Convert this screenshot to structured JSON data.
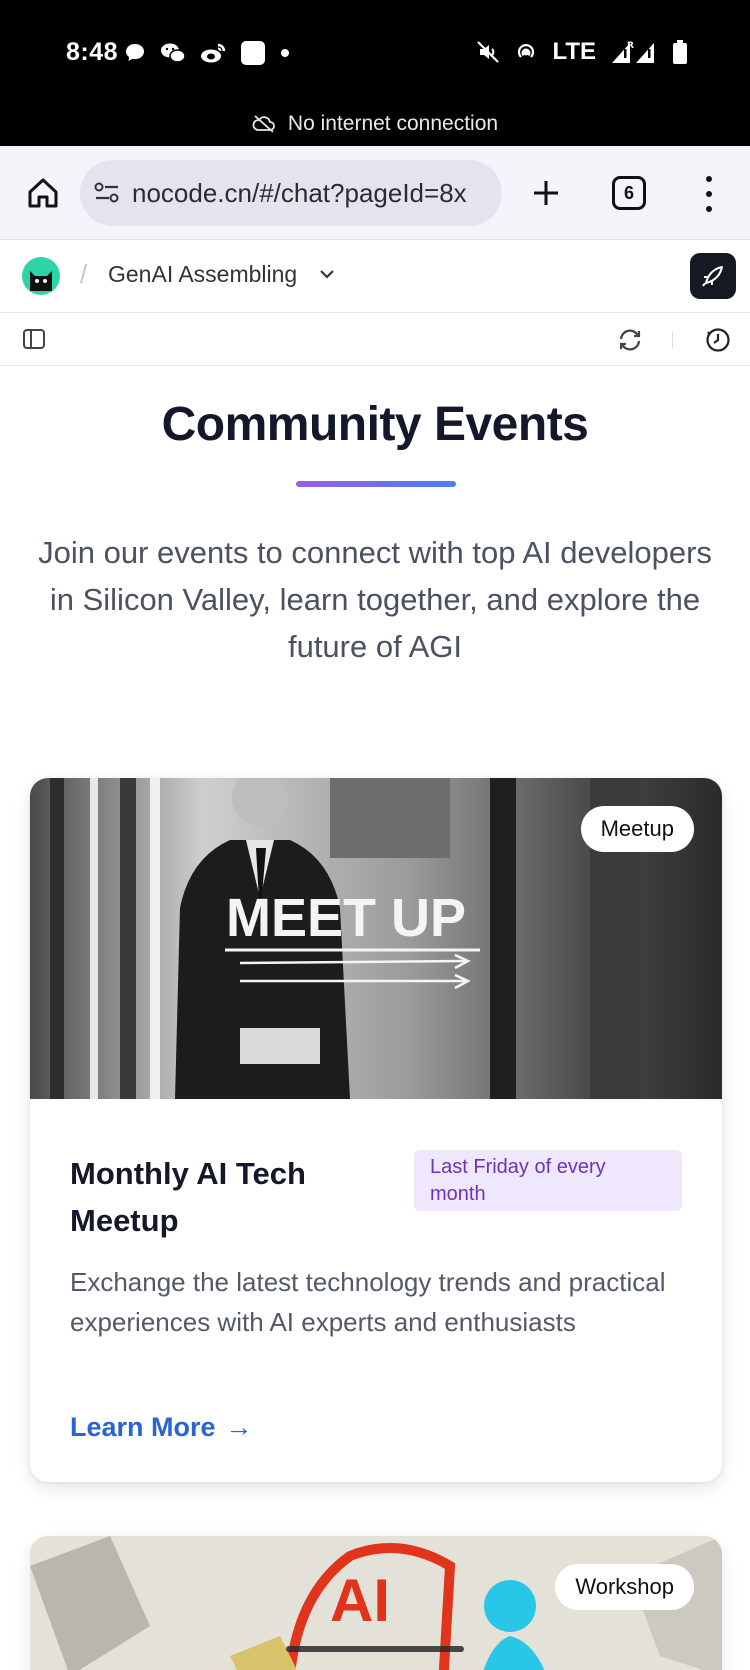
{
  "status_bar": {
    "time": "8:48",
    "network": "LTE",
    "offline_message": "No internet connection",
    "icons": [
      "chat-bubble-icon",
      "wechat-icon",
      "weibo-icon",
      "app-square-icon",
      "dot-icon",
      "mute-icon",
      "hotspot-icon",
      "signal-icon",
      "battery-icon"
    ]
  },
  "browser": {
    "url": "nocode.cn/#/chat?pageId=8x",
    "tab_count": "6"
  },
  "app_header": {
    "separator": "/",
    "project_name": "GenAI Assembling"
  },
  "section": {
    "title": "Community Events",
    "description": "Join our events to connect with top AI developers in Silicon Valley, learn together, and explore the future of AGI"
  },
  "events": [
    {
      "tag": "Meetup",
      "image_text": "MEET UP",
      "title": "Monthly AI Tech Meetup",
      "schedule": "Last Friday of every month",
      "description": "Exchange the latest technology trends and practical experiences with AI experts and enthusiasts",
      "cta": "Learn More",
      "cta_arrow": "→"
    },
    {
      "tag": "Workshop",
      "image_text": "AI"
    }
  ],
  "colors": {
    "accent_blue": "#2a64d4",
    "badge_purple_bg": "#efe7fc",
    "badge_purple_text": "#6b34b8",
    "title_dark": "#15172b"
  }
}
